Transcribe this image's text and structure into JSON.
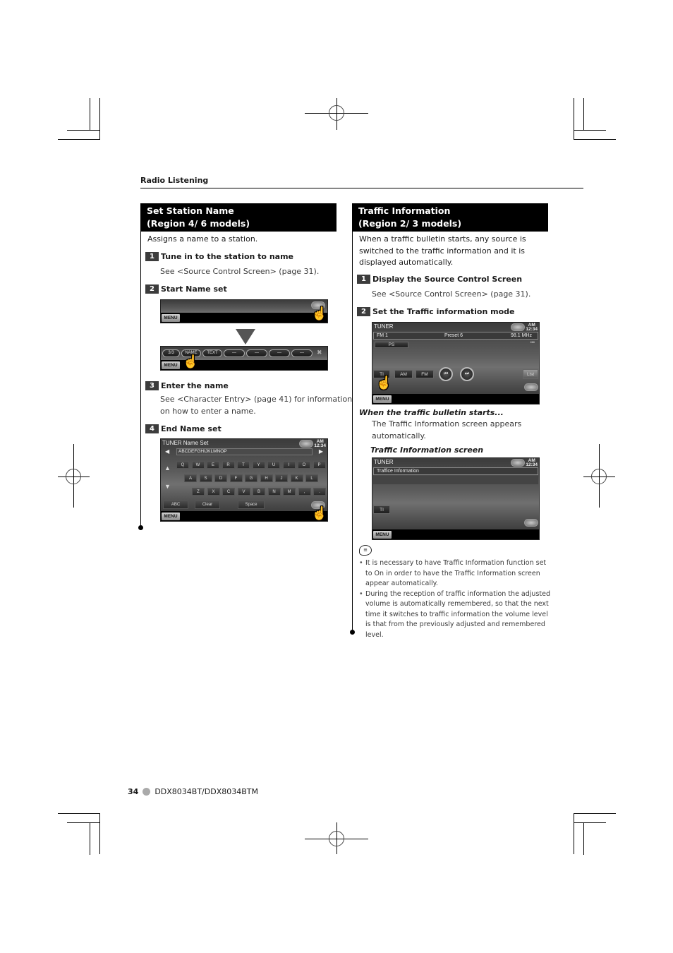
{
  "running_head": "Radio Listening",
  "left_section": {
    "title_line1": "Set Station Name",
    "title_line2": "(Region 4/ 6 models)",
    "intro": "Assigns a name to a station.",
    "steps": [
      {
        "num": "1",
        "title": "Tune in to the station to name",
        "desc": "See <Source Control Screen> (page 31)."
      },
      {
        "num": "2",
        "title": "Start Name set"
      },
      {
        "num": "3",
        "title": "Enter the name",
        "desc_line1": "See <Character Entry> (page 41) for information",
        "desc_line2": "on how to enter a name."
      },
      {
        "num": "4",
        "title": "End Name set"
      }
    ],
    "screen_a": {
      "menu": "MENU"
    },
    "screen_b": {
      "menu": "MENU",
      "buttons": [
        "3/3",
        "NAME",
        "TEXT",
        "—",
        "—",
        "—",
        "—"
      ]
    },
    "screen_c": {
      "title": "TUNER Name Set",
      "clock_ampm": "AM",
      "clock_time": "12:34",
      "entry": "ABCDEFGHIJKLMNOP",
      "row1": [
        "Q",
        "W",
        "E",
        "R",
        "T",
        "Y",
        "U",
        "I",
        "O",
        "P"
      ],
      "row2": [
        "A",
        "S",
        "D",
        "F",
        "G",
        "H",
        "J",
        "K",
        "L"
      ],
      "row3": [
        "Z",
        "X",
        "C",
        "V",
        "B",
        "N",
        "M",
        ",",
        "."
      ],
      "abc": "ABC",
      "clear": "Clear",
      "space": "Space",
      "menu": "MENU"
    }
  },
  "right_section": {
    "title_line1": "Traffic Information",
    "title_line2": "(Region 2/ 3 models)",
    "intro_line1": "When a traffic bulletin starts, any source is",
    "intro_line2": "switched to the traffic information and it is",
    "intro_line3": "displayed automatically.",
    "steps": [
      {
        "num": "1",
        "title": "Display the Source Control Screen",
        "desc": "See <Source Control Screen> (page 31)."
      },
      {
        "num": "2",
        "title": "Set the Traffic information mode"
      }
    ],
    "screen_tuner": {
      "title": "TUNER",
      "clock_ampm": "AM",
      "clock_time": "12:34",
      "band": "FM 1",
      "preset": "Preset 6",
      "freq": "98.1 MHz",
      "ps": "PS",
      "ti": "TI",
      "am": "AM",
      "fm": "FM",
      "prev": "⏮",
      "next": "⏭",
      "list": "List",
      "menu": "MENU"
    },
    "bulletin_heading": "When the traffic bulletin starts...",
    "bulletin_line1": "The Traffic Information screen appears",
    "bulletin_line2": "automatically.",
    "ti_screen_caption": "Traffic Information screen",
    "screen_traffic": {
      "title": "TUNER",
      "clock_ampm": "AM",
      "clock_time": "12:34",
      "info": "Traffice Information",
      "ti": "TI",
      "menu": "MENU"
    },
    "notes": [
      "It is necessary to have Traffic Information function set to On in order to have the Traffic Information screen appear automatically.",
      "During the reception of traffic information the adjusted volume is automatically remembered, so that the next time it switches to traffic information the volume level is that from the previously adjusted and remembered level."
    ]
  },
  "footer": {
    "page": "34",
    "model": "DDX8034BT/DDX8034BTM"
  }
}
